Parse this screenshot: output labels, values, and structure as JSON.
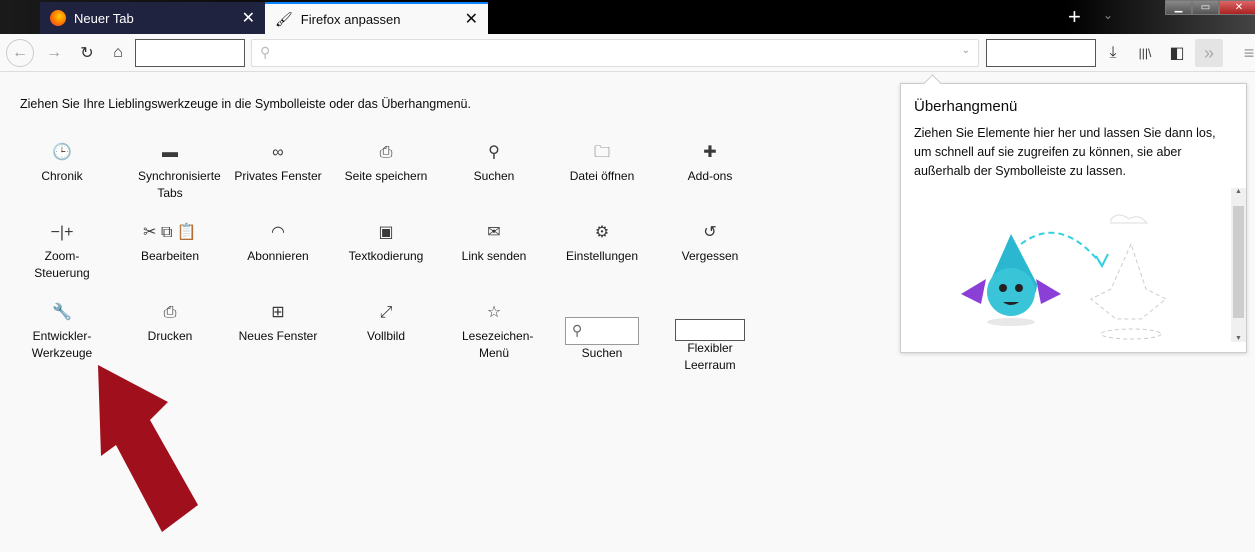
{
  "tabs": [
    {
      "label": "Neuer Tab",
      "close": "✕"
    },
    {
      "label": "Firefox anpassen",
      "close": "✕"
    }
  ],
  "window": {
    "new_tab": "+",
    "tab_list": "⌄",
    "minimize": "▁",
    "maximize": "▭",
    "close": "✕"
  },
  "toolbar": {
    "back": "←",
    "forward": "→",
    "reload": "↻",
    "home": "⌂",
    "search_icon": "⚲",
    "dropdown": "⌄",
    "download": "⤓",
    "library": "|||\\",
    "sidebar": "◧",
    "overflow": "»",
    "menu": "≡"
  },
  "intro": "Ziehen Sie Ihre Lieblingswerkzeuge in die Symbolleiste oder das Überhangmenü.",
  "items": [
    {
      "label": "Chronik",
      "icon": "🕒",
      "name": "history"
    },
    {
      "label": "Synchronisierte Tabs",
      "icon": "▬",
      "name": "synced-tabs"
    },
    {
      "label": "Privates Fenster",
      "icon": "∞",
      "name": "private-window"
    },
    {
      "label": "Seite speichern",
      "icon": "⎙",
      "name": "save-page"
    },
    {
      "label": "Suchen",
      "icon": "⚲",
      "name": "search"
    },
    {
      "label": "Datei öffnen",
      "icon": "🗀",
      "name": "open-file"
    },
    {
      "label": "Add-ons",
      "icon": "✚",
      "name": "addons"
    },
    {
      "label": "Zoom-Steuerung",
      "icon": "−|+",
      "name": "zoom-controls"
    },
    {
      "label": "Bearbeiten",
      "icon": "✂ ⧉ 📋",
      "name": "edit-controls"
    },
    {
      "label": "Abonnieren",
      "icon": "◠",
      "name": "subscribe"
    },
    {
      "label": "Textkodierung",
      "icon": "▣",
      "name": "text-encoding"
    },
    {
      "label": "Link senden",
      "icon": "✉",
      "name": "email-link"
    },
    {
      "label": "Einstellungen",
      "icon": "⚙",
      "name": "preferences"
    },
    {
      "label": "Vergessen",
      "icon": "↺",
      "name": "forget"
    },
    {
      "label": "Entwickler-Werkzeuge",
      "icon": "🔧",
      "name": "developer-tools"
    },
    {
      "label": "Drucken",
      "icon": "⎙",
      "name": "print"
    },
    {
      "label": "Neues Fenster",
      "icon": "⊞",
      "name": "new-window"
    },
    {
      "label": "Vollbild",
      "icon": "⤢",
      "name": "fullscreen"
    },
    {
      "label": "Lesezeichen-Menü",
      "icon": "☆",
      "name": "bookmarks-menu"
    },
    {
      "label": "Suchen",
      "icon": "search-box",
      "name": "search-box"
    },
    {
      "label": "Flexibler Leerraum",
      "icon": "spacer",
      "name": "flexible-space"
    }
  ],
  "panel": {
    "title": "Überhangmenü",
    "description": "Ziehen Sie Elemente hier her und lassen Sie dann los, um schnell auf sie zugreifen zu können, sie aber außerhalb der Symbolleiste zu lassen.",
    "scroll_up": "▲",
    "scroll_down": "▼"
  },
  "colors": {
    "arrow": "#a00f1c",
    "accent": "#0a84ff"
  }
}
